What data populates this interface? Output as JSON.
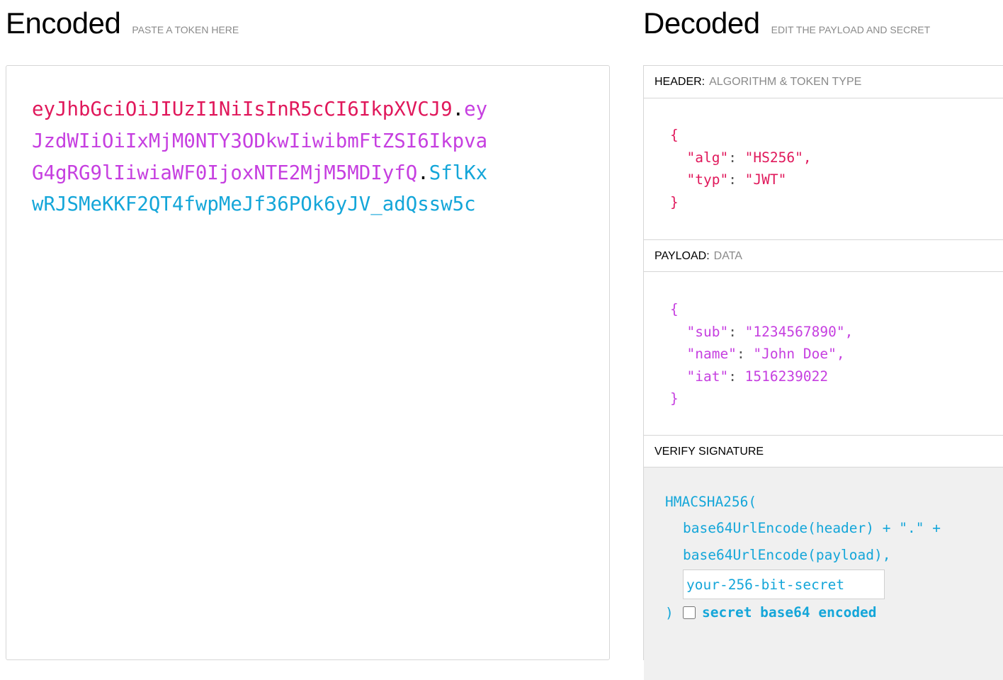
{
  "encoded": {
    "title": "Encoded",
    "subtitle": "PASTE A TOKEN HERE",
    "token_lines": [
      {
        "header": "eyJhbGciOiJIUzI1NiIsInR5cCI6IkpXVCJ9",
        "dot1": ".",
        "payload": "ey"
      },
      {
        "payload": "JzdWIiOiIxMjM0NTY3ODkwIiwibmFtZSI6Ikpva"
      },
      {
        "payload": "G4gRG9lIiwiaWF0IjoxNTE2MjM5MDIyfQ",
        "dot2": ".",
        "signature": "SflKx"
      },
      {
        "signature": "wRJSMeKKF2QT4fwpMeJf36POk6yJV_adQssw5c"
      }
    ]
  },
  "decoded": {
    "title": "Decoded",
    "subtitle": "EDIT THE PAYLOAD AND SECRET",
    "header_section": {
      "label": "HEADER:",
      "sublabel": "ALGORITHM & TOKEN TYPE",
      "json": {
        "alg": "HS256",
        "typ": "JWT"
      }
    },
    "payload_section": {
      "label": "PAYLOAD:",
      "sublabel": "DATA",
      "json": {
        "sub": "1234567890",
        "name": "John Doe",
        "iat": 1516239022
      }
    },
    "verify_section": {
      "label": "VERIFY SIGNATURE",
      "line1": "HMACSHA256(",
      "line2": "base64UrlEncode(header) + \".\" +",
      "line3": "base64UrlEncode(payload),",
      "secret_placeholder": "your-256-bit-secret",
      "closing": ")",
      "checkbox_label": "secret base64 encoded",
      "checkbox_checked": false
    }
  },
  "colors": {
    "header": "#e0185b",
    "payload": "#c63fe0",
    "signature": "#14a6d9"
  }
}
